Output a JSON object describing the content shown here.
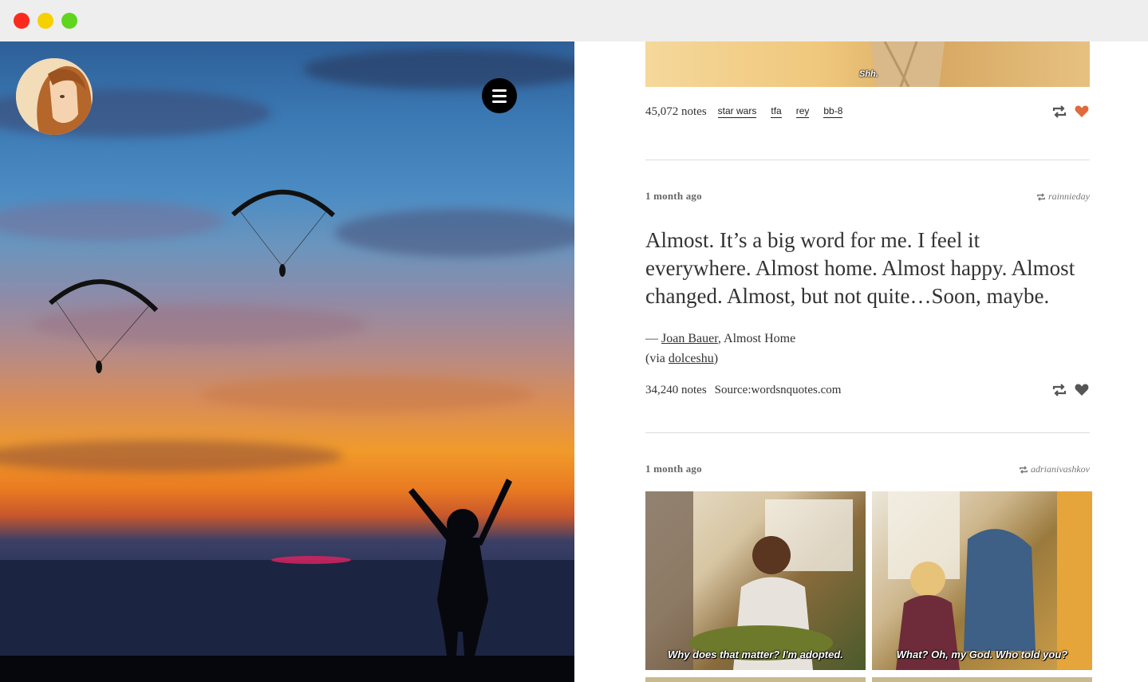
{
  "window": {
    "controls": [
      "close",
      "minimize",
      "maximize"
    ]
  },
  "hero": {
    "avatar_icon": "avatar-illustration",
    "menu_icon": "hamburger-menu-icon"
  },
  "post1": {
    "gif_caption": "Shh.",
    "notes": "45,072 notes",
    "tags": [
      "star wars",
      "tfa",
      "rey",
      "bb-8"
    ],
    "liked": true,
    "like_color": "#e06a3b"
  },
  "post2": {
    "date": "1 month ago",
    "reblogged_from": "rainnieday",
    "quote": "Almost. It’s a big word for me. I feel it everywhere. Almost home. Almost happy. Almost changed. Almost, but not quite…Soon, maybe.",
    "attribution_dash": "— ",
    "author": "Joan Bauer",
    "work": ", Almost Home",
    "via_prefix": "(via ",
    "via_user": "dolceshu",
    "via_suffix": ")",
    "notes": "34,240 notes",
    "source": "Source:wordsnquotes.com",
    "like_color": "#555555"
  },
  "post3": {
    "date": "1 month ago",
    "reblogged_from": "adrianivashkov",
    "photos": [
      {
        "caption": "Why does that matter? I'm adopted."
      },
      {
        "caption": "What? Oh, my God. Who told you?"
      }
    ]
  }
}
